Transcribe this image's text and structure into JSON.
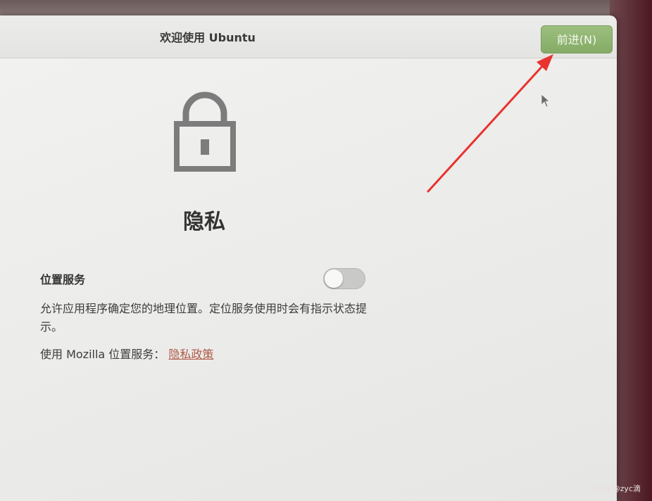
{
  "header": {
    "title": "欢迎使用 Ubuntu",
    "forward_label": "前进(N)"
  },
  "page": {
    "title": "隐私"
  },
  "location_service": {
    "label": "位置服务",
    "enabled": false,
    "description": "允许应用程序确定您的地理位置。定位服务使用时会有指示状态提示。",
    "mozilla_text": "使用 Mozilla 位置服务：",
    "privacy_link": "隐私政策"
  },
  "icons": {
    "lock": "lock-icon",
    "cursor": "mouse-pointer-icon"
  },
  "annotation": {
    "arrow_color": "#e8332f"
  },
  "watermark": "CSDN @zyc滴",
  "colors": {
    "accent_button": "#8fb472",
    "link": "#b05a48"
  }
}
